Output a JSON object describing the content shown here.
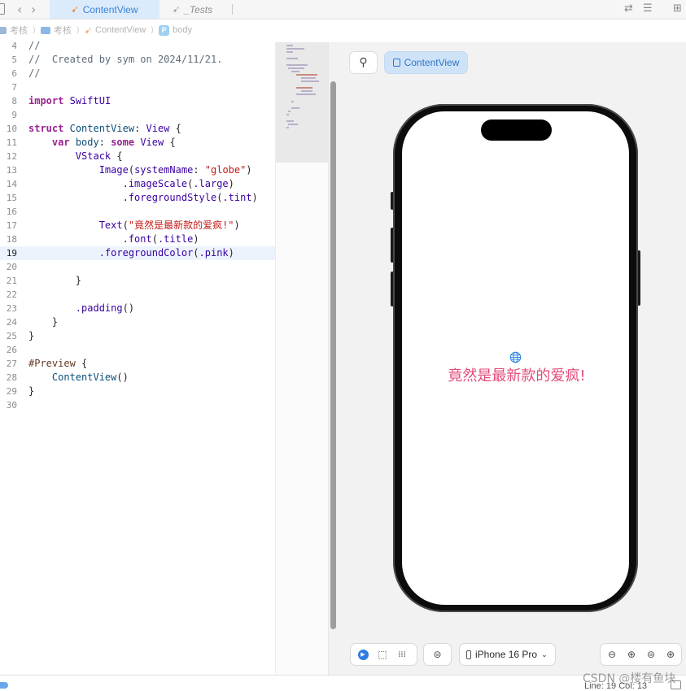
{
  "tabs": [
    {
      "label": "ContentView",
      "active": true,
      "icon": "swift-icon"
    },
    {
      "label": "_Tests",
      "active": false,
      "icon": "swift-icon"
    }
  ],
  "breadcrumb": {
    "items": [
      {
        "label": "考核",
        "icon": "folder-icon"
      },
      {
        "label": "考核",
        "icon": "folder-icon"
      },
      {
        "label": "ContentView",
        "icon": "swift-icon"
      },
      {
        "label": "body",
        "icon": "property-icon",
        "badge": "P"
      }
    ],
    "separator": "⟩"
  },
  "editor": {
    "current_line": 19,
    "lines": [
      {
        "num": "4",
        "text": "//"
      },
      {
        "num": "5",
        "text": "//  Created by sym on 2024/11/21."
      },
      {
        "num": "6",
        "text": "//"
      },
      {
        "num": "7",
        "text": ""
      },
      {
        "num": "8",
        "text": "import SwiftUI"
      },
      {
        "num": "9",
        "text": ""
      },
      {
        "num": "10",
        "text": "struct ContentView: View {"
      },
      {
        "num": "11",
        "text": "    var body: some View {"
      },
      {
        "num": "12",
        "text": "        VStack {"
      },
      {
        "num": "13",
        "text": "            Image(systemName: \"globe\")"
      },
      {
        "num": "14",
        "text": "                .imageScale(.large)"
      },
      {
        "num": "15",
        "text": "                .foregroundStyle(.tint)"
      },
      {
        "num": "16",
        "text": ""
      },
      {
        "num": "17",
        "text": "            Text(\"竟然是最新款的爱疯!\")"
      },
      {
        "num": "18",
        "text": "                .font(.title)"
      },
      {
        "num": "19",
        "text": "            .foregroundColor(.pink)"
      },
      {
        "num": "20",
        "text": ""
      },
      {
        "num": "21",
        "text": "        }"
      },
      {
        "num": "22",
        "text": ""
      },
      {
        "num": "23",
        "text": "        .padding()"
      },
      {
        "num": "24",
        "text": "    }"
      },
      {
        "num": "25",
        "text": "}"
      },
      {
        "num": "26",
        "text": ""
      },
      {
        "num": "27",
        "text": "#Preview {"
      },
      {
        "num": "28",
        "text": "    ContentView()"
      },
      {
        "num": "29",
        "text": "}"
      },
      {
        "num": "30",
        "text": ""
      }
    ]
  },
  "canvas": {
    "pin_icon": "pin-icon",
    "preview_button_label": "ContentView",
    "preview_text": "竟然是最新款的爱疯!",
    "preview_text_color": "#e34b78",
    "globe_icon": "globe-icon",
    "device_label": "iPhone 16 Pro",
    "toolbar_icons": [
      "live-preview-icon",
      "selectable-icon",
      "variants-icon",
      "device-settings-icon",
      "zoom-out-icon",
      "zoom-in-icon",
      "zoom-fit-icon",
      "zoom-100-icon"
    ]
  },
  "statusbar": {
    "position": "Line: 19  Col: 13"
  },
  "watermark": "CSDN @楼有鱼块",
  "colors": {
    "accent": "#2c76c8",
    "active_tab_bg": "#dcebfb",
    "current_line_bg": "#ecf3fc",
    "canvas_bg": "#f2f2f2"
  }
}
